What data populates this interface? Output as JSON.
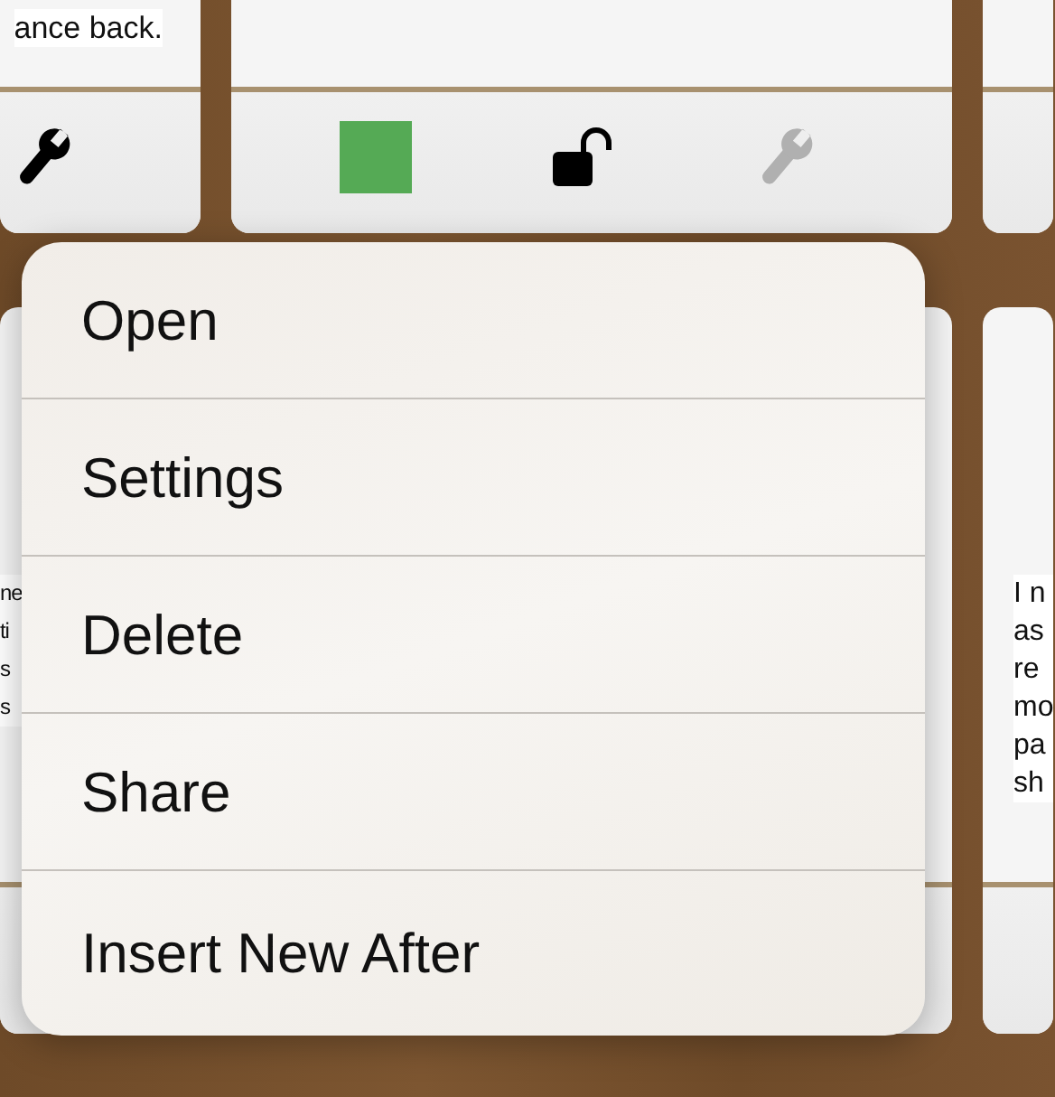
{
  "top_row": {
    "left_card": {
      "text_lines": [
        "ance back."
      ],
      "tools": [
        {
          "kind": "wrench",
          "disabled": false
        }
      ]
    },
    "middle_card": {
      "tools": [
        {
          "kind": "swatch",
          "color": "#55aa55"
        },
        {
          "kind": "lock",
          "locked": false
        },
        {
          "kind": "wrench",
          "disabled": true
        }
      ]
    }
  },
  "bottom_row": {
    "left_card": {
      "text_lines": [
        "ne",
        "ti",
        "s",
        "s"
      ]
    },
    "right_card": {
      "text_lines": [
        "I n",
        "as",
        "re",
        "mo",
        "pa",
        "sh"
      ]
    }
  },
  "context_menu": {
    "items": [
      "Open",
      "Settings",
      "Delete",
      "Share",
      "Insert New After"
    ]
  }
}
